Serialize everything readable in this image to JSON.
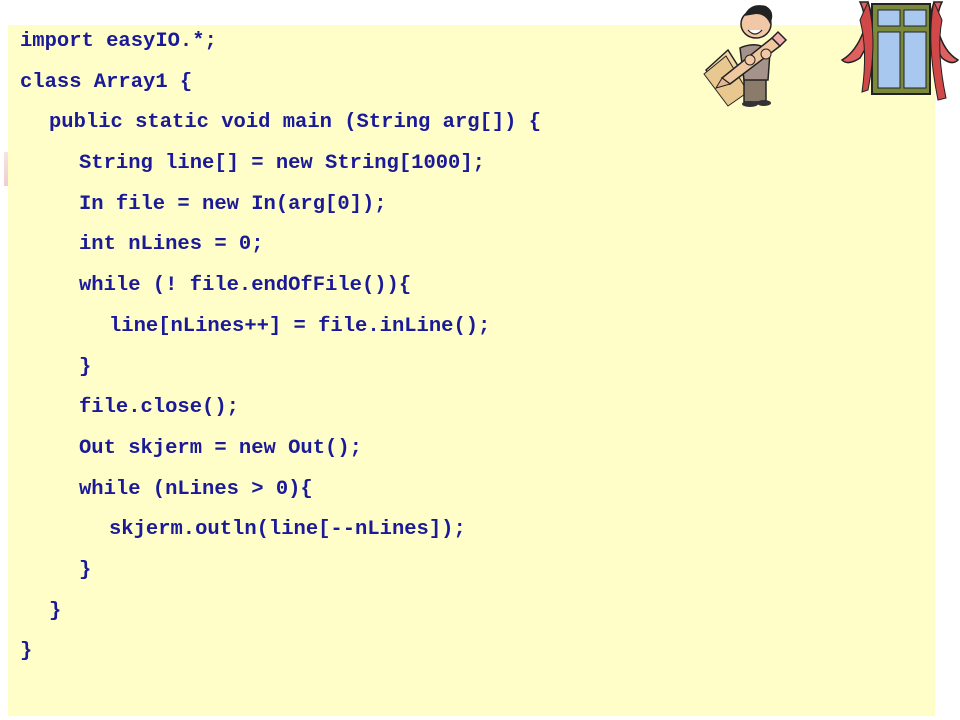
{
  "slide": {
    "code_lines": [
      {
        "indent": 0,
        "text": "import easyIO.*;"
      },
      {
        "indent": 0,
        "text": "class Array1 {"
      },
      {
        "indent": 1,
        "text": "public static void main (String arg[]) {"
      },
      {
        "indent": 2,
        "text": "String line[] = new String[1000];"
      },
      {
        "indent": 2,
        "text": "In file = new In(arg[0]);"
      },
      {
        "indent": 2,
        "text": "int nLines = 0;"
      },
      {
        "indent": 2,
        "text": "while (! file.endOfFile()){"
      },
      {
        "indent": 3,
        "text": "line[nLines++] = file.inLine();"
      },
      {
        "indent": 2,
        "text": "}"
      },
      {
        "indent": 2,
        "text": "file.close();"
      },
      {
        "indent": 2,
        "text": "Out skjerm = new Out();"
      },
      {
        "indent": 2,
        "text": "while (nLines > 0){"
      },
      {
        "indent": 3,
        "text": "skjerm.outln(line[--nLines]);"
      },
      {
        "indent": 2,
        "text": "}"
      },
      {
        "indent": 1,
        "text": "}"
      },
      {
        "indent": 0,
        "text": "}"
      }
    ],
    "illustrations": [
      "man-with-pencil-clipart",
      "window-with-curtains-clipart"
    ],
    "colors": {
      "code_text": "#1a1a99",
      "panel_background": "#fffdc8"
    }
  }
}
